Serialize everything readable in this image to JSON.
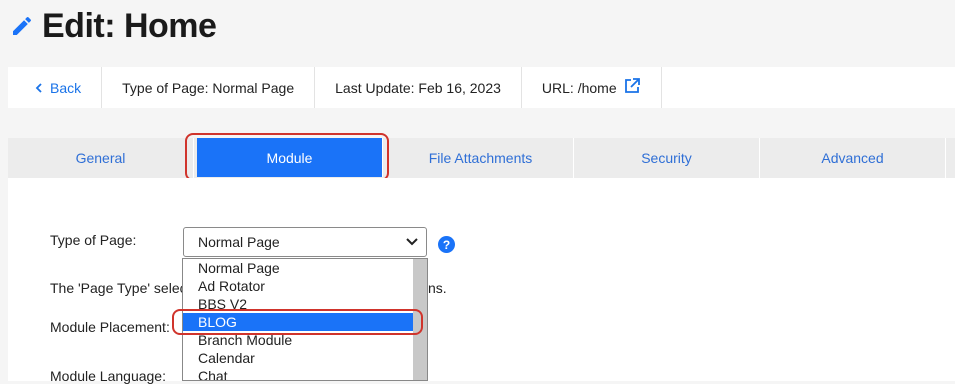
{
  "page": {
    "title": "Edit: Home"
  },
  "infobar": {
    "back": "Back",
    "type_of_page": "Type of Page: Normal Page",
    "last_update": "Last Update: Feb 16, 2023",
    "url": "URL: /home"
  },
  "tabs": [
    "General",
    "Module",
    "File Attachments",
    "Security",
    "Advanced"
  ],
  "active_tab": "Module",
  "form": {
    "type_of_page_label": "Type of Page:",
    "type_of_page_value": "Normal Page",
    "page_type_desc_start": "The 'Page Type' selec",
    "page_type_desc_end": "ns.",
    "module_placement_label": "Module Placement:",
    "module_language_label": "Module Language:"
  },
  "dropdown_options": [
    "Normal Page",
    "Ad Rotator",
    "BBS V2",
    "BLOG",
    "Branch Module",
    "Calendar",
    "Chat"
  ],
  "dropdown_highlighted": "BLOG",
  "colors": {
    "accent": "#1a73f8",
    "highlight_border": "#d0342c",
    "link": "#1a73e8"
  }
}
